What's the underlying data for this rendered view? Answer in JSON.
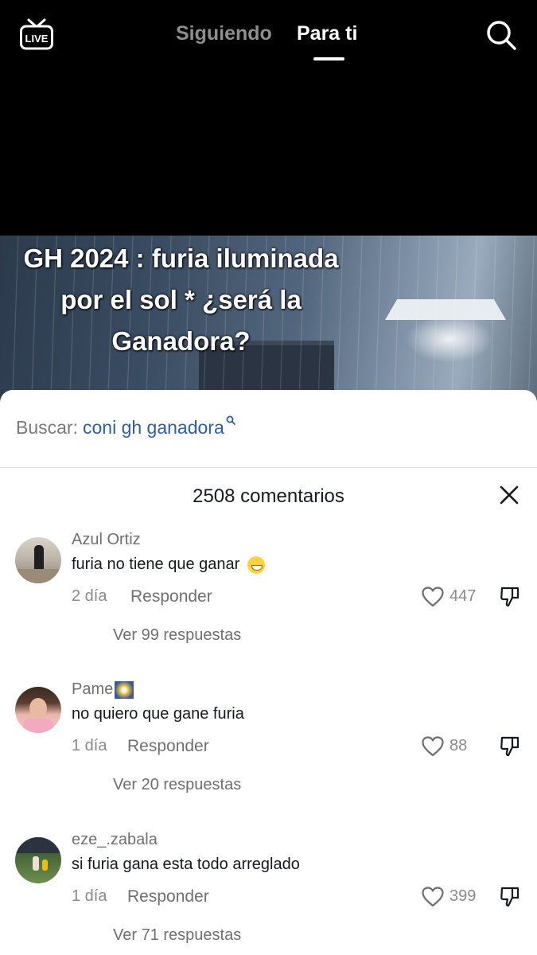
{
  "topbar": {
    "live_label": "LIVE",
    "tab_following": "Siguiendo",
    "tab_for_you": "Para ti",
    "active_tab": "Para ti"
  },
  "video": {
    "caption_lines": [
      "GH 2024 : furia iluminada",
      "por el sol * ¿será la",
      "Ganadora?"
    ]
  },
  "comments_sheet": {
    "search_label": "Buscar:",
    "search_query": "coni gh ganadora",
    "comment_count": "2508 comentarios",
    "comments": [
      {
        "username": "Azul Ortiz",
        "text": "furia no tiene que ganar",
        "emoji": "grinning-face",
        "time": "2 día",
        "reply_label": "Responder",
        "likes": "447",
        "view_replies": "Ver 99 respuestas"
      },
      {
        "username": "Pame",
        "username_emoji": "sparkle-image",
        "text": "no quiero que gane furia",
        "time": "1 día",
        "reply_label": "Responder",
        "likes": "88",
        "view_replies": "Ver 20 respuestas"
      },
      {
        "username": "eze_.zabala",
        "text": "si furia gana esta todo arreglado",
        "time": "1 día",
        "reply_label": "Responder",
        "likes": "399",
        "view_replies": "Ver 71 respuestas"
      }
    ]
  },
  "colors": {
    "search_query": "#2c5ea8",
    "background_top": "#000000",
    "sheet": "#ffffff"
  },
  "icons": [
    "live-icon",
    "search-icon",
    "close-icon",
    "heart-icon",
    "dislike-icon"
  ]
}
